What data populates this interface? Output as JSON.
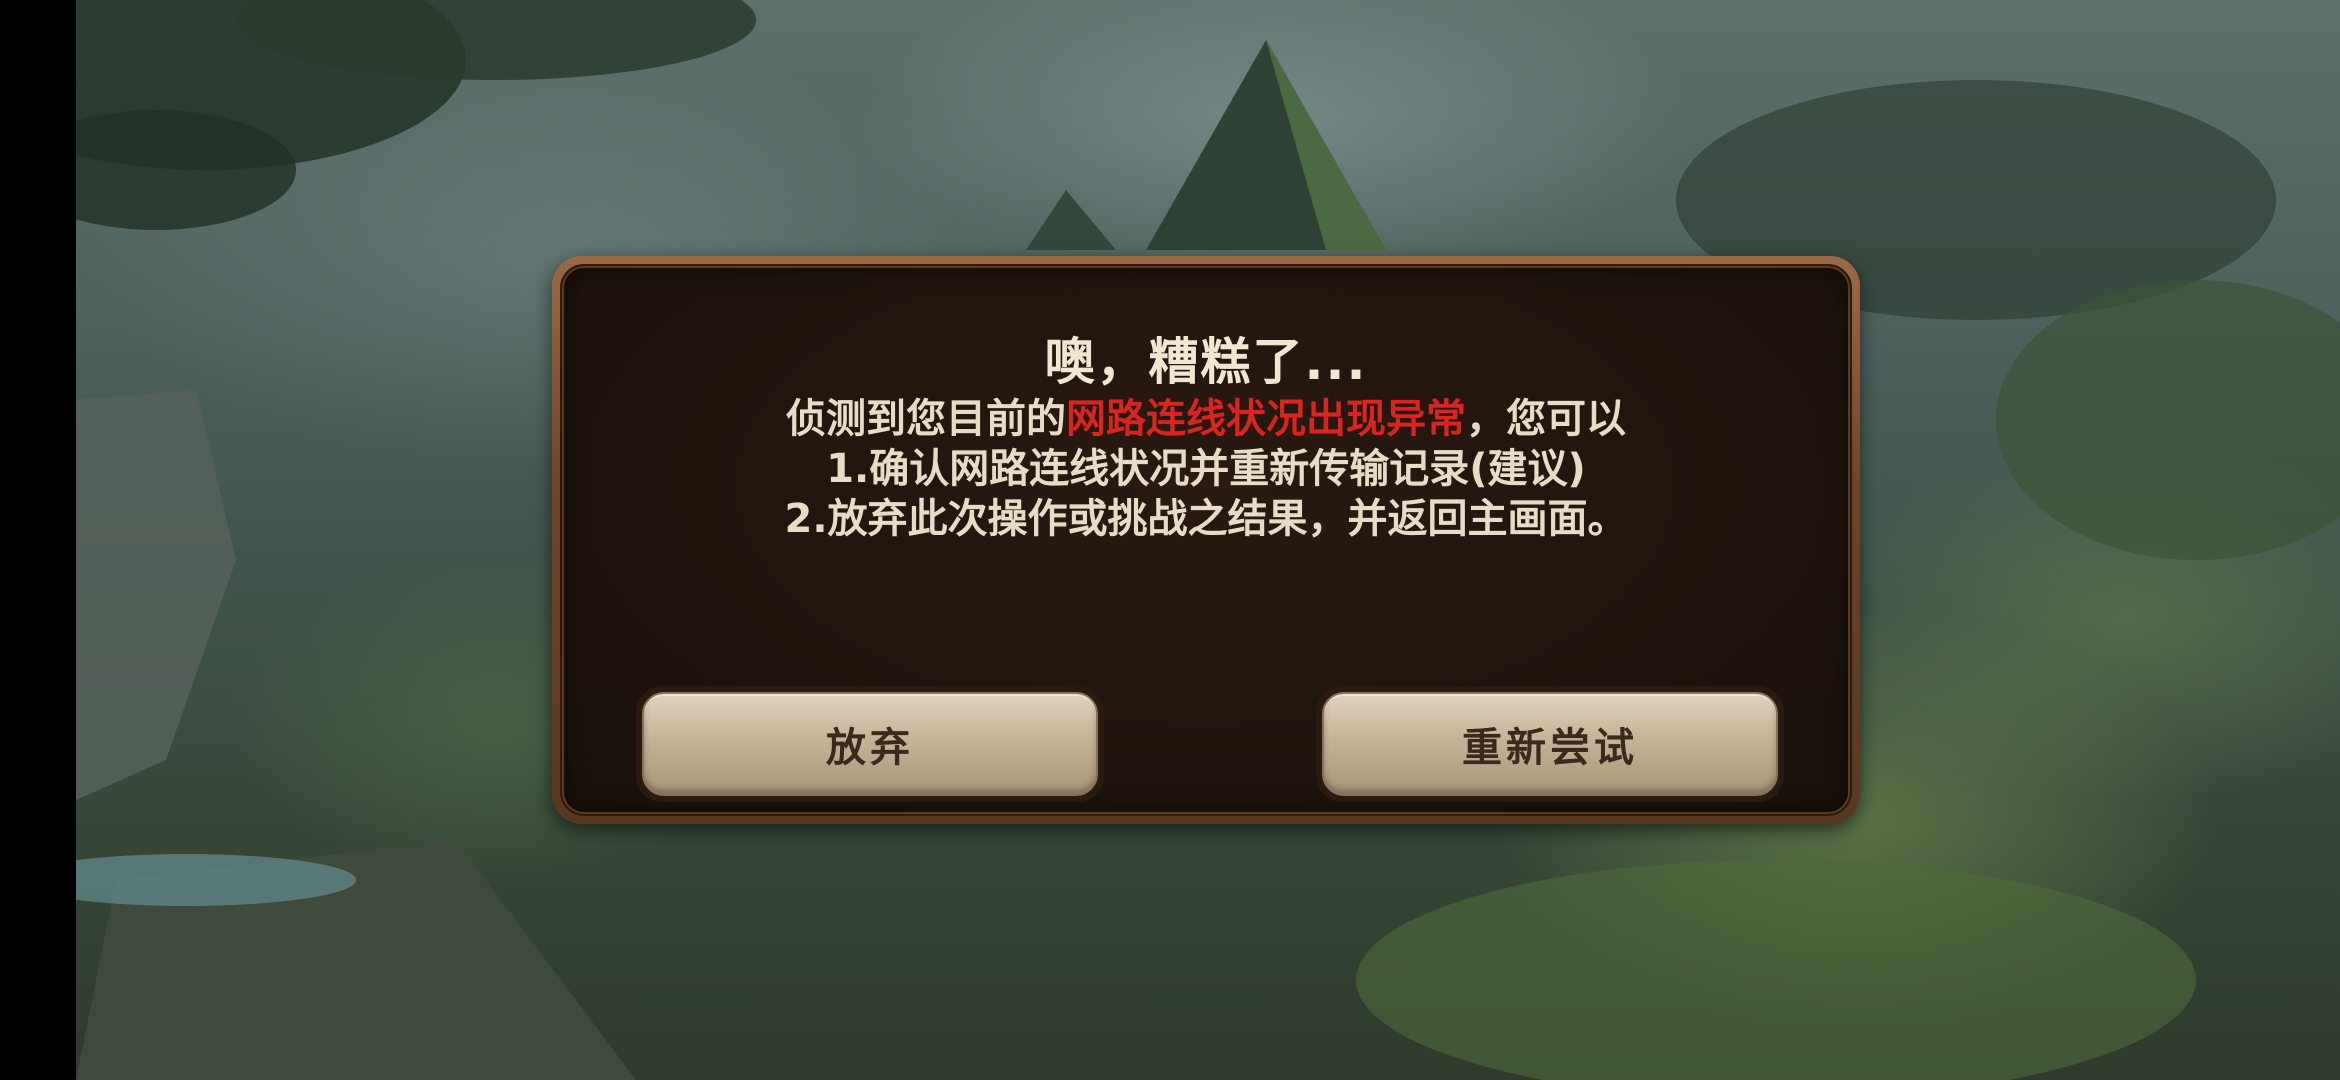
{
  "dialog": {
    "title": "噢，糟糕了...",
    "message": {
      "line1_prefix": "侦测到您目前的",
      "line1_highlight": "网路连线状况出现异常",
      "line1_suffix": "，您可以",
      "line2": "1.确认网路连线状况并重新传输记录(建议)",
      "line3": "2.放弃此次操作或挑战之结果，并返回主画面。"
    },
    "buttons": {
      "abandon_label": "放弃",
      "retry_label": "重新尝试"
    }
  },
  "colors": {
    "highlight": "#d9241f",
    "dialog_frame": "#6e4527",
    "dialog_bg": "#1f140d",
    "button_face": "#c7b397",
    "text": "#e8dcc6"
  }
}
